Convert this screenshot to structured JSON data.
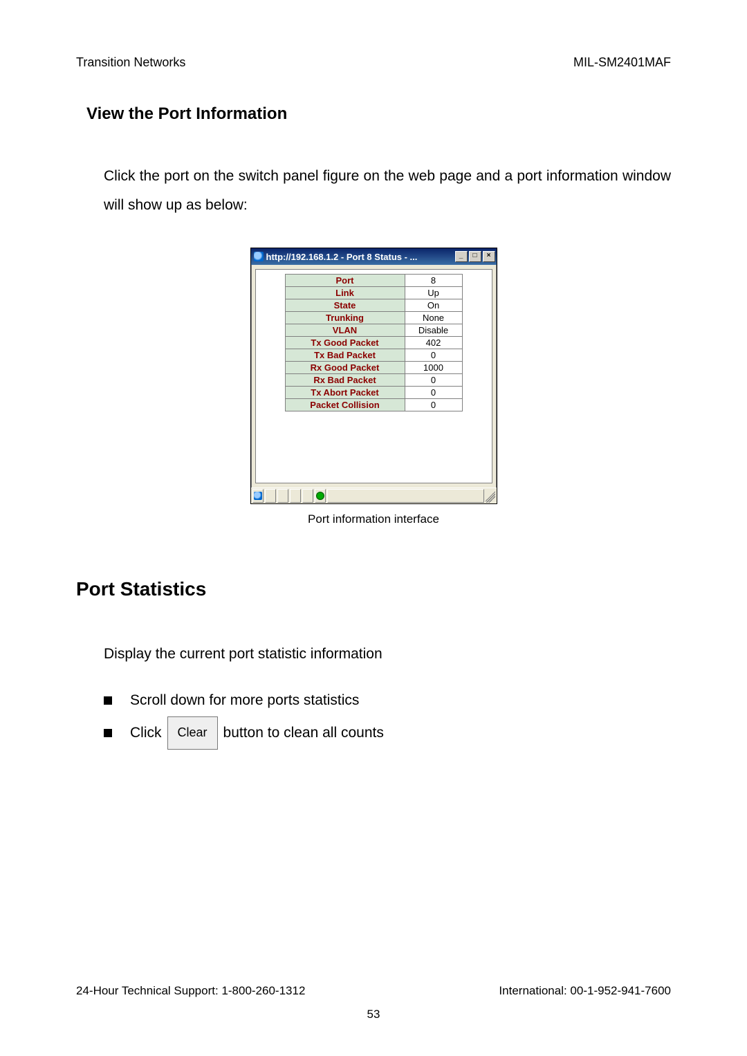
{
  "header": {
    "left": "Transition Networks",
    "right": "MIL-SM2401MAF"
  },
  "section1": {
    "title": "View the Port Information",
    "paragraph": "Click the port on the switch panel figure on the web page and a port information window will show up as below:"
  },
  "dialog": {
    "title": "http://192.168.1.2 - Port 8 Status - ...",
    "min": "_",
    "max": "□",
    "close": "×",
    "rows": [
      {
        "label": "Port",
        "value": "8"
      },
      {
        "label": "Link",
        "value": "Up"
      },
      {
        "label": "State",
        "value": "On"
      },
      {
        "label": "Trunking",
        "value": "None"
      },
      {
        "label": "VLAN",
        "value": "Disable"
      },
      {
        "label": "Tx Good Packet",
        "value": "402"
      },
      {
        "label": "Tx Bad Packet",
        "value": "0"
      },
      {
        "label": "Rx Good Packet",
        "value": "1000"
      },
      {
        "label": "Rx Bad Packet",
        "value": "0"
      },
      {
        "label": "Tx Abort Packet",
        "value": "0"
      },
      {
        "label": "Packet Collision",
        "value": "0"
      }
    ]
  },
  "caption": "Port information interface",
  "section2": {
    "title": "Port Statistics",
    "intro": "Display the current port statistic information",
    "bullet1": "Scroll down for more ports statistics",
    "bullet2_pre": "Click",
    "bullet2_btn": "Clear",
    "bullet2_post": "button to clean all counts"
  },
  "footer": {
    "left": "24-Hour Technical Support: 1-800-260-1312",
    "right": "International: 00-1-952-941-7600",
    "page": "53"
  }
}
